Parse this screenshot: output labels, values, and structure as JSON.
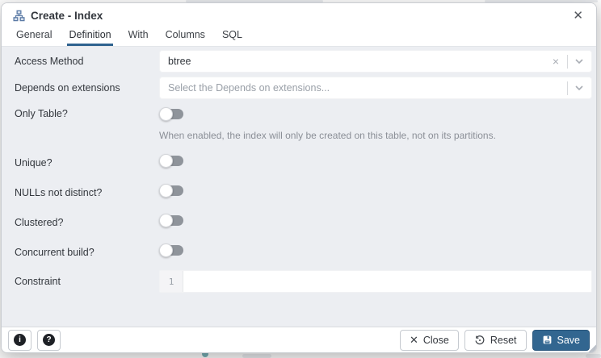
{
  "window": {
    "title": "Create - Index"
  },
  "tabs": [
    {
      "label": "General",
      "active": false
    },
    {
      "label": "Definition",
      "active": true
    },
    {
      "label": "With",
      "active": false
    },
    {
      "label": "Columns",
      "active": false
    },
    {
      "label": "SQL",
      "active": false
    }
  ],
  "form": {
    "access_method": {
      "label": "Access Method",
      "value": "btree"
    },
    "depends_on_extensions": {
      "label": "Depends on extensions",
      "placeholder": "Select the Depends on extensions..."
    },
    "only_table": {
      "label": "Only Table?",
      "state": "off",
      "help": "When enabled, the index will only be created on this table, not on its partitions."
    },
    "unique": {
      "label": "Unique?",
      "state": "off"
    },
    "nulls_not_distinct": {
      "label": "NULLs not distinct?",
      "state": "off"
    },
    "clustered": {
      "label": "Clustered?",
      "state": "off"
    },
    "concurrent_build": {
      "label": "Concurrent build?",
      "state": "off"
    },
    "constraint": {
      "label": "Constraint",
      "line_number": "1",
      "value": ""
    }
  },
  "footer": {
    "close_label": "Close",
    "reset_label": "Reset",
    "save_label": "Save"
  },
  "glyphs": {
    "window_close": "✕",
    "select_clear": "×",
    "button_close_x": "✕",
    "info": "i",
    "help": "?"
  },
  "colors": {
    "accent": "#326690",
    "body_background": "#eceef2",
    "toggle_track": "#8f949b"
  }
}
